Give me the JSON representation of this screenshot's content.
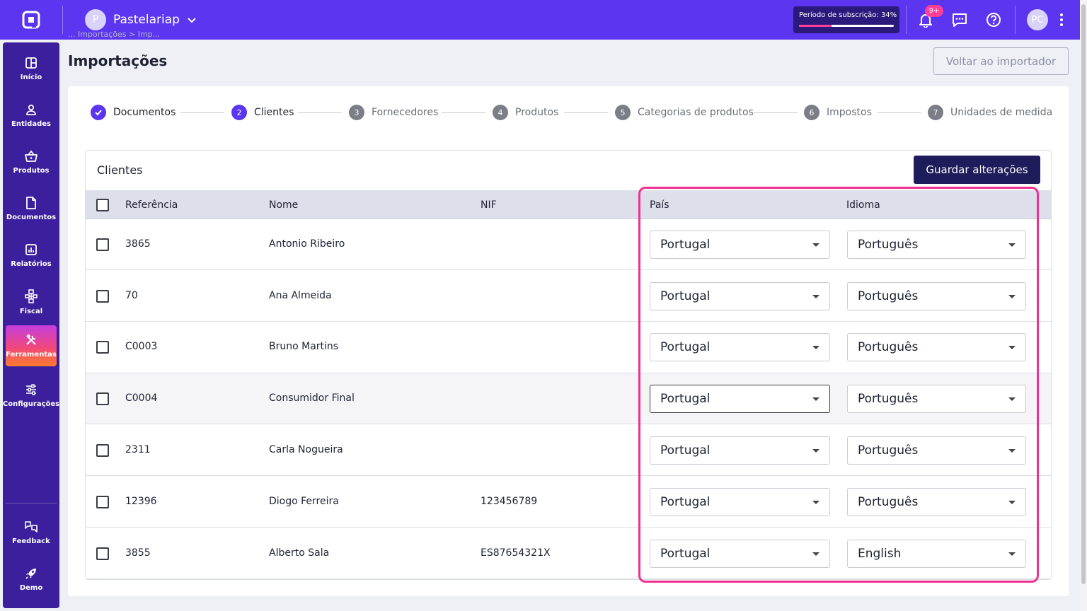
{
  "topbar": {
    "company_initial": "P",
    "company_name": "Pastelariap",
    "subscription_label": "Período de subscrição: 34%",
    "subscription_progress_pct": 34,
    "notifications_badge": "9+",
    "user_initials": "PC"
  },
  "sidebar": {
    "items": [
      {
        "label": "Início",
        "icon": "dashboard-icon"
      },
      {
        "label": "Entidades",
        "icon": "person-icon"
      },
      {
        "label": "Produtos",
        "icon": "basket-icon"
      },
      {
        "label": "Documentos",
        "icon": "document-icon"
      },
      {
        "label": "Relatórios",
        "icon": "chart-icon"
      },
      {
        "label": "Fiscal",
        "icon": "hierarchy-icon"
      },
      {
        "label": "Ferramentas",
        "icon": "tools-icon",
        "active": true
      },
      {
        "label": "Configurações",
        "icon": "sliders-icon"
      }
    ],
    "bottom_items": [
      {
        "label": "Feedback",
        "icon": "feedback-icon"
      },
      {
        "label": "Demo",
        "icon": "rocket-icon"
      }
    ]
  },
  "page": {
    "breadcrumb_ghost": "... Importações > Imp...",
    "title": "Importações",
    "back_button": "Voltar ao importador"
  },
  "steps": [
    {
      "num": "1",
      "label": "Documentos",
      "state": "done"
    },
    {
      "num": "2",
      "label": "Clientes",
      "state": "current"
    },
    {
      "num": "3",
      "label": "Fornecedores",
      "state": "pending"
    },
    {
      "num": "4",
      "label": "Produtos",
      "state": "pending"
    },
    {
      "num": "5",
      "label": "Categorias de produtos",
      "state": "pending"
    },
    {
      "num": "6",
      "label": "Impostos",
      "state": "pending"
    },
    {
      "num": "7",
      "label": "Unidades de medida",
      "state": "pending"
    }
  ],
  "panel": {
    "title": "Clientes",
    "save_button": "Guardar alterações"
  },
  "table": {
    "columns": [
      "Referência",
      "Nome",
      "NIF",
      "País",
      "Idioma"
    ],
    "rows": [
      {
        "ref": "3865",
        "name": "Antonio Ribeiro",
        "nif": "",
        "country": "Portugal",
        "language": "Português"
      },
      {
        "ref": "70",
        "name": "Ana Almeida",
        "nif": "",
        "country": "Portugal",
        "language": "Português"
      },
      {
        "ref": "C0003",
        "name": "Bruno Martins",
        "nif": "",
        "country": "Portugal",
        "language": "Português"
      },
      {
        "ref": "C0004",
        "name": "Consumidor Final",
        "nif": "",
        "country": "Portugal",
        "language": "Português"
      },
      {
        "ref": "2311",
        "name": "Carla Nogueira",
        "nif": "",
        "country": "Portugal",
        "language": "Português"
      },
      {
        "ref": "12396",
        "name": "Diogo Ferreira",
        "nif": "123456789",
        "country": "Portugal",
        "language": "Português"
      },
      {
        "ref": "3855",
        "name": "Alberto Sala",
        "nif": "ES87654321X",
        "country": "Portugal",
        "language": "English"
      }
    ]
  },
  "colors": {
    "brand": "#5b35f0",
    "sidebar": "#3b1f9d",
    "highlight": "#f0318f",
    "save_button": "#1e1c5a"
  }
}
